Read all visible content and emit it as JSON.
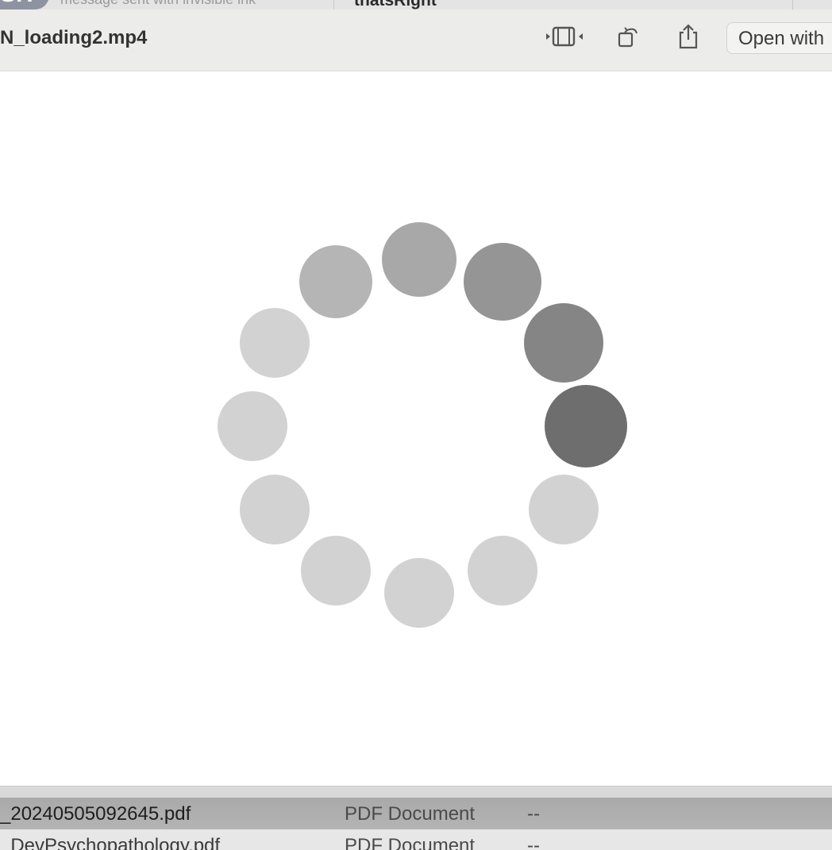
{
  "background_window": {
    "avatar_text": "SH",
    "message_preview": "message sent with invisible ink",
    "title": "thatsRight"
  },
  "quicklook": {
    "file_title": "N_loading2.mp4",
    "buttons": {
      "trim_icon": "trim-icon",
      "rotate_icon": "rotate-icon",
      "share_icon": "share-icon",
      "open_with_label": "Open with"
    }
  },
  "spinner": {
    "dot_count": 12,
    "colors": [
      "#6e6e6e",
      "#858585",
      "#959595",
      "#a8a8a8",
      "#b5b5b5",
      "#d2d2d2",
      "#d2d2d2",
      "#d2d2d2",
      "#d2d2d2",
      "#d2d2d2",
      "#d2d2d2",
      "#d2d2d2"
    ]
  },
  "file_list": {
    "rows": [
      {
        "name": "_20240505092645.pdf",
        "kind": "PDF Document",
        "size": "--"
      },
      {
        "name": "_DevPsychopathology.pdf",
        "kind": "PDF Document",
        "size": "--"
      }
    ]
  }
}
